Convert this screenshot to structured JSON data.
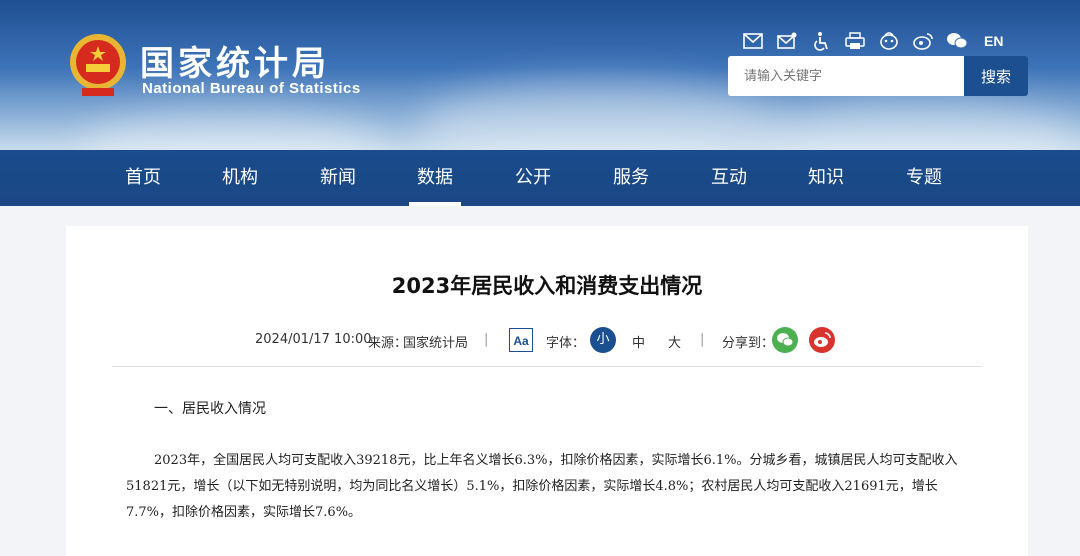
{
  "header": {
    "logo_cn": "国家统计局",
    "logo_en": "National Bureau of Statistics",
    "lang": "EN",
    "icons": [
      "mail-icon",
      "mailbox-icon",
      "accessibility-icon",
      "print-icon",
      "app-icon",
      "weibo-icon",
      "wechat-icon"
    ]
  },
  "search": {
    "placeholder": "请输入关键字",
    "button": "搜索"
  },
  "nav": {
    "items": [
      "首页",
      "机构",
      "新闻",
      "数据",
      "公开",
      "服务",
      "互动",
      "知识",
      "专题"
    ],
    "active": "数据"
  },
  "article": {
    "title": "2023年居民收入和消费支出情况",
    "date": "2024/01/17 10:00",
    "source_label": "来源：",
    "source": "国家统计局",
    "sep": "|",
    "aa": "Aa",
    "font_label": "字体：",
    "font_small": "小",
    "font_mid": "中",
    "font_large": "大",
    "share_label": "分享到：",
    "section1": "一、居民收入情况",
    "para1": "2023年，全国居民人均可支配收入39218元，比上年名义增长6.3%，扣除价格因素，实际增长6.1%。分城乡看，城镇居民人均可支配收入51821元，增长（以下如无特别说明，均为同比名义增长）5.1%，扣除价格因素，实际增长4.8%；农村居民人均可支配收入21691元，增长7.7%，扣除价格因素，实际增长7.6%。"
  },
  "colors": {
    "primary": "#1b4f8f",
    "wechat": "#4caf50",
    "weibo": "#d9332e"
  }
}
